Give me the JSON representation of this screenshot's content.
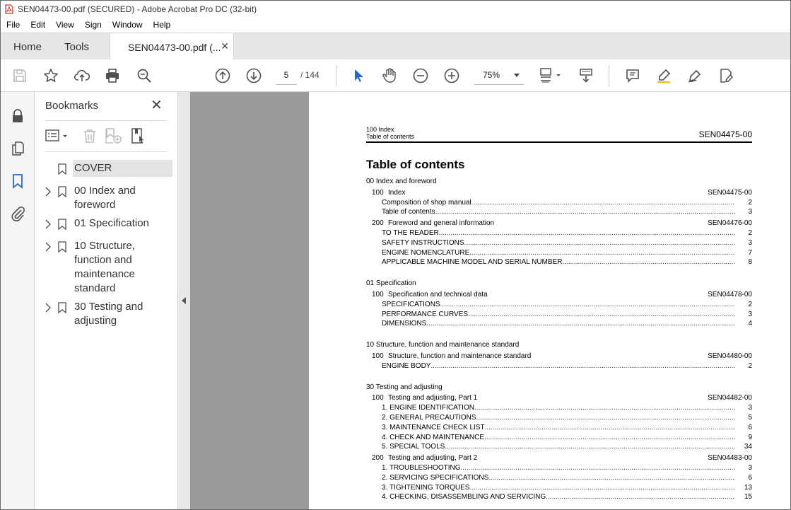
{
  "window": {
    "title": "SEN04473-00.pdf (SECURED) - Adobe Acrobat Pro DC (32-bit)"
  },
  "menu": [
    "File",
    "Edit",
    "View",
    "Sign",
    "Window",
    "Help"
  ],
  "tabs": {
    "home": "Home",
    "tools": "Tools",
    "document": "SEN04473-00.pdf (..."
  },
  "toolbar": {
    "page_current": "5",
    "page_total": "/ 144",
    "zoom": "75%"
  },
  "bookmarks": {
    "title": "Bookmarks",
    "items": [
      {
        "label": "COVER",
        "expandable": false,
        "selected": true
      },
      {
        "label": "00 Index and foreword",
        "expandable": true
      },
      {
        "label": "01 Specification",
        "expandable": true
      },
      {
        "label": "10 Structure, function and maintenance standard",
        "expandable": true
      },
      {
        "label": "30 Testing and adjusting",
        "expandable": true
      }
    ]
  },
  "document": {
    "header_left_1": "100 Index",
    "header_left_2": "Table of contents",
    "header_right": "SEN04475-00",
    "title": "Table of contents",
    "sections": [
      {
        "title": "00 Index and foreword",
        "chapters": [
          {
            "num": "100",
            "name": "Index",
            "code": "SEN04475-00",
            "entries": [
              {
                "name": "Composition of shop manual",
                "page": "2"
              },
              {
                "name": "Table of contents",
                "page": "3"
              }
            ]
          },
          {
            "num": "200",
            "name": "Foreword and general information",
            "code": "SEN04476-00",
            "entries": [
              {
                "name": "TO THE READER",
                "page": "2"
              },
              {
                "name": "SAFETY INSTRUCTIONS",
                "page": "3"
              },
              {
                "name": "ENGINE NOMENCLATURE",
                "page": "7"
              },
              {
                "name": "APPLICABLE MACHINE MODEL AND SERIAL NUMBER",
                "page": "8"
              }
            ]
          }
        ]
      },
      {
        "title": "01 Specification",
        "chapters": [
          {
            "num": "100",
            "name": "Specification and technical data",
            "code": "SEN04478-00",
            "entries": [
              {
                "name": "SPECIFICATIONS",
                "page": "2"
              },
              {
                "name": "PERFORMANCE CURVES",
                "page": "3"
              },
              {
                "name": "DIMENSIONS",
                "page": "4"
              }
            ]
          }
        ]
      },
      {
        "title": "10 Structure, function and maintenance standard",
        "chapters": [
          {
            "num": "100",
            "name": "Structure, function and maintenance standard",
            "code": "SEN04480-00",
            "entries": [
              {
                "name": "ENGINE BODY",
                "page": "2"
              }
            ]
          }
        ]
      },
      {
        "title": "30 Testing and adjusting",
        "chapters": [
          {
            "num": "100",
            "name": "Testing and adjusting, Part 1",
            "code": "SEN04482-00",
            "entries": [
              {
                "name": "1. ENGINE IDENTIFICATION",
                "page": "3"
              },
              {
                "name": "2. GENERAL PRECAUTIONS",
                "page": "5"
              },
              {
                "name": "3. MAINTENANCE CHECK LIST",
                "page": "6"
              },
              {
                "name": "4. CHECK AND MAINTENANCE",
                "page": "9"
              },
              {
                "name": "5. SPECIAL TOOLS",
                "page": "34"
              }
            ]
          },
          {
            "num": "200",
            "name": "Testing and adjusting, Part 2",
            "code": "SEN04483-00",
            "entries": [
              {
                "name": "1. TROUBLESHOOTING",
                "page": "3"
              },
              {
                "name": "2. SERVICING SPECIFICATIONS",
                "page": "6"
              },
              {
                "name": "3. TIGHTENING TORQUES",
                "page": "13"
              },
              {
                "name": "4. CHECKING, DISASSEMBLING AND SERVICING",
                "page": "15"
              }
            ]
          }
        ]
      }
    ]
  },
  "colors": {
    "accent": "#2a68c8",
    "canvas_bg": "#9a9a9a",
    "icon_gray": "#505050",
    "pdf_red": "#d62a1e"
  }
}
